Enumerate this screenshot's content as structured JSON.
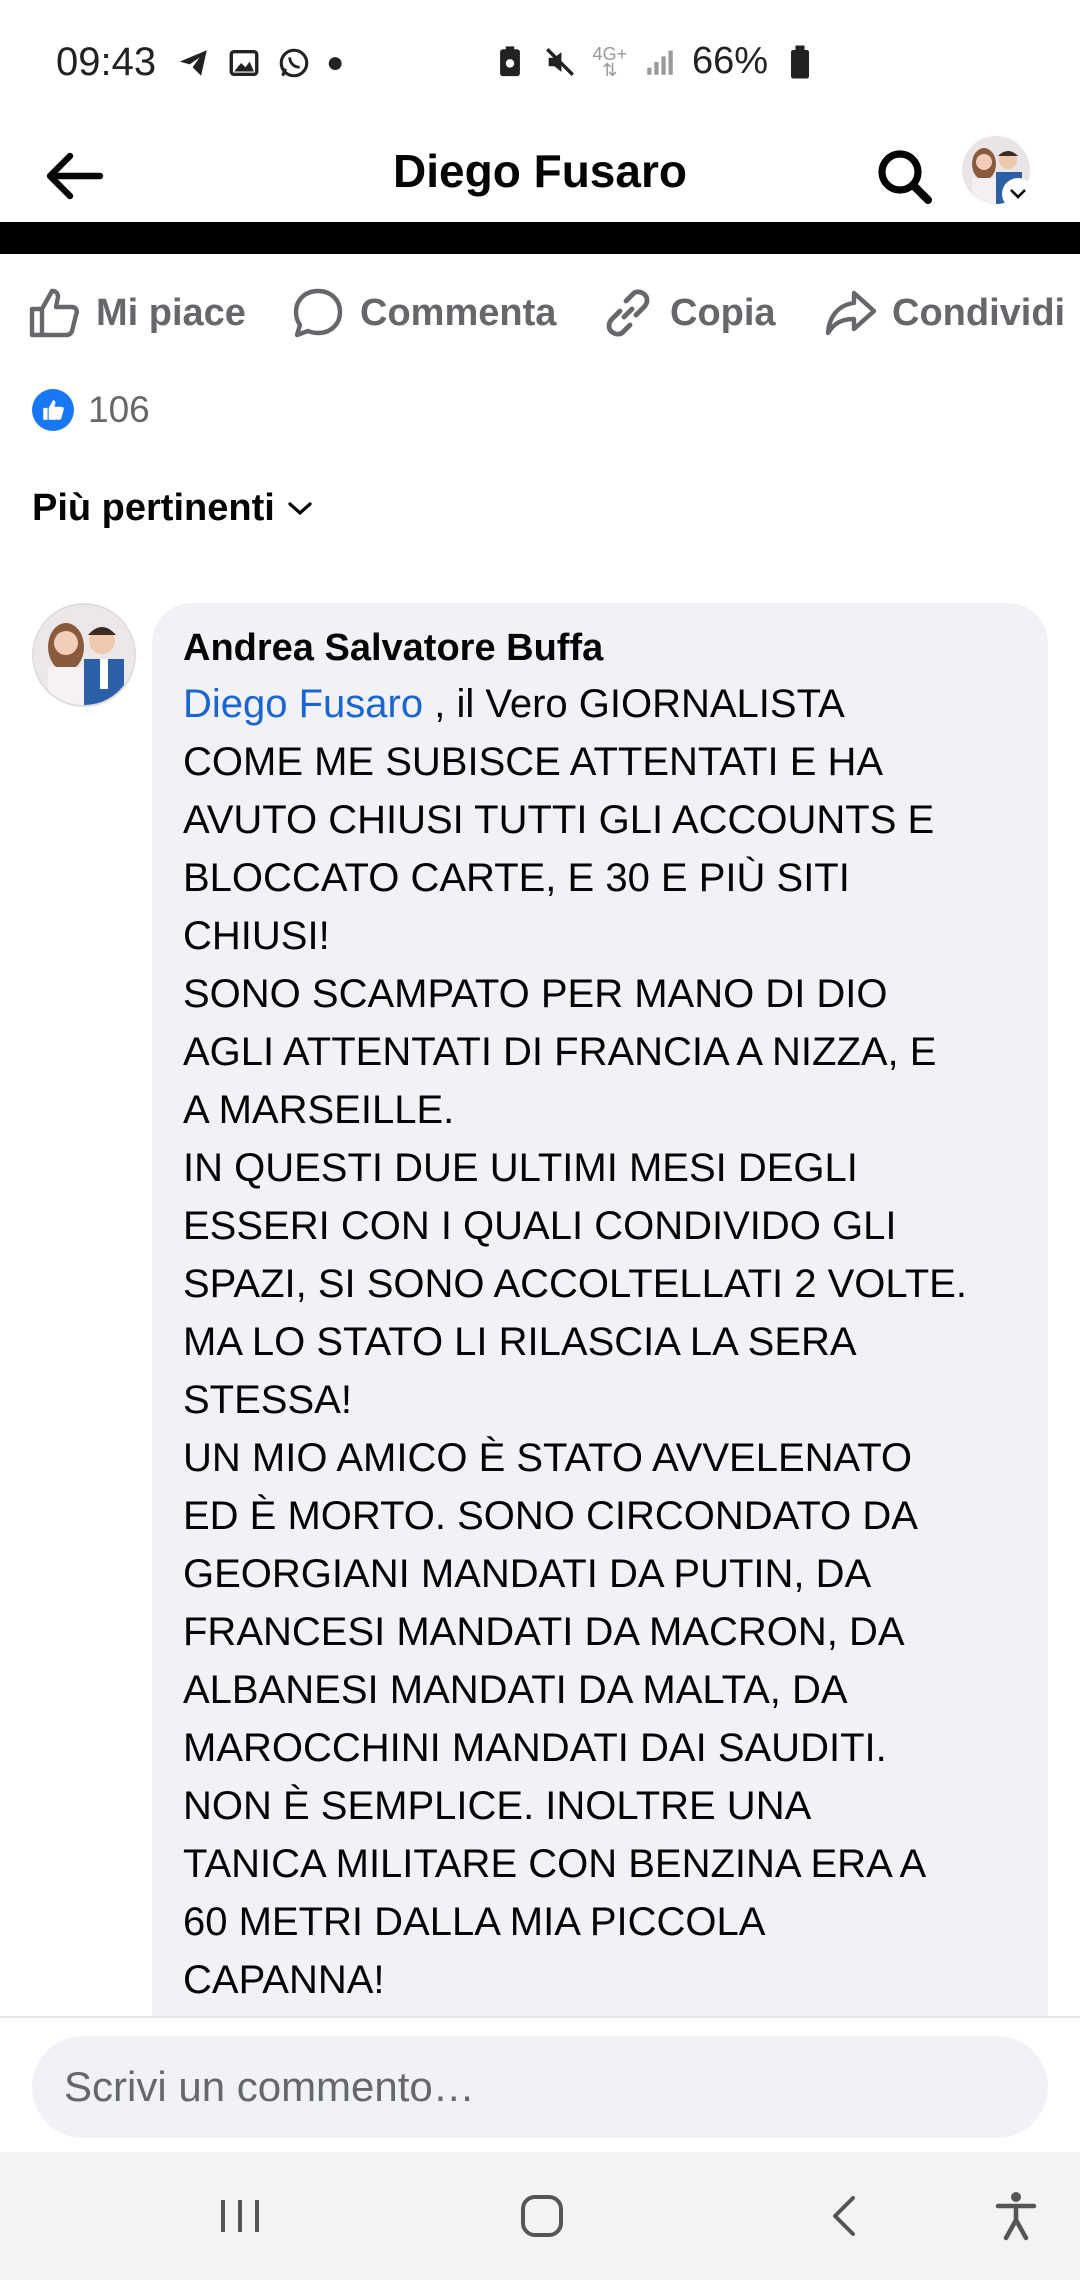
{
  "status_bar": {
    "time": "09:43",
    "battery": "66%",
    "network": "4G+",
    "left_icons": [
      "telegram-icon",
      "gallery-icon",
      "whatsapp-icon",
      "dot-icon"
    ],
    "right_icons": [
      "battery-saver-icon",
      "mute-icon",
      "network-icon",
      "signal-icon",
      "battery-icon"
    ]
  },
  "header": {
    "title": "Diego Fusaro"
  },
  "actions": {
    "like": "Mi piace",
    "comment": "Commenta",
    "copy": "Copia",
    "share": "Condividi"
  },
  "reactions": {
    "count": "106"
  },
  "sort": {
    "label": "Più pertinenti"
  },
  "comment": {
    "author": "Andrea Salvatore Buffa",
    "mention": "Diego Fusaro",
    "text": " , il Vero GIORNALISTA\nCOME ME SUBISCE ATTENTATI E HA\nAVUTO CHIUSI TUTTI GLI ACCOUNTS E\nBLOCCATO CARTE, E 30 E PIÙ SITI\nCHIUSI!\nSONO SCAMPATO PER MANO DI DIO\nAGLI ATTENTATI DI FRANCIA A NIZZA, E\nA MARSEILLE.\nIN QUESTI DUE ULTIMI MESI DEGLI\nESSERI CON I QUALI CONDIVIDO GLI\nSPAZI, SI SONO ACCOLTELLATI 2 VOLTE.\nMA LO STATO LI RILASCIA LA SERA\nSTESSA!\nUN MIO AMICO È STATO AVVELENATO\nED È MORTO. SONO CIRCONDATO DA\nGEORGIANI MANDATI DA PUTIN, DA\nFRANCESI MANDATI DA MACRON, DA\nALBANESI MANDATI DA MALTA, DA\nMAROCCHINI MANDATI DAI SAUDITI.\nNON È SEMPLICE. INOLTRE UNA\nTANICA MILITARE CON BENZINA ERA A\n60 METRI DALLA MIA PICCOLA\nCAPANNA!"
  },
  "composer": {
    "placeholder": "Scrivi un commento…"
  },
  "colors": {
    "accent": "#1877f2",
    "mention": "#1a65d1",
    "muted": "#65676b",
    "bubble": "#f0f2f5"
  }
}
